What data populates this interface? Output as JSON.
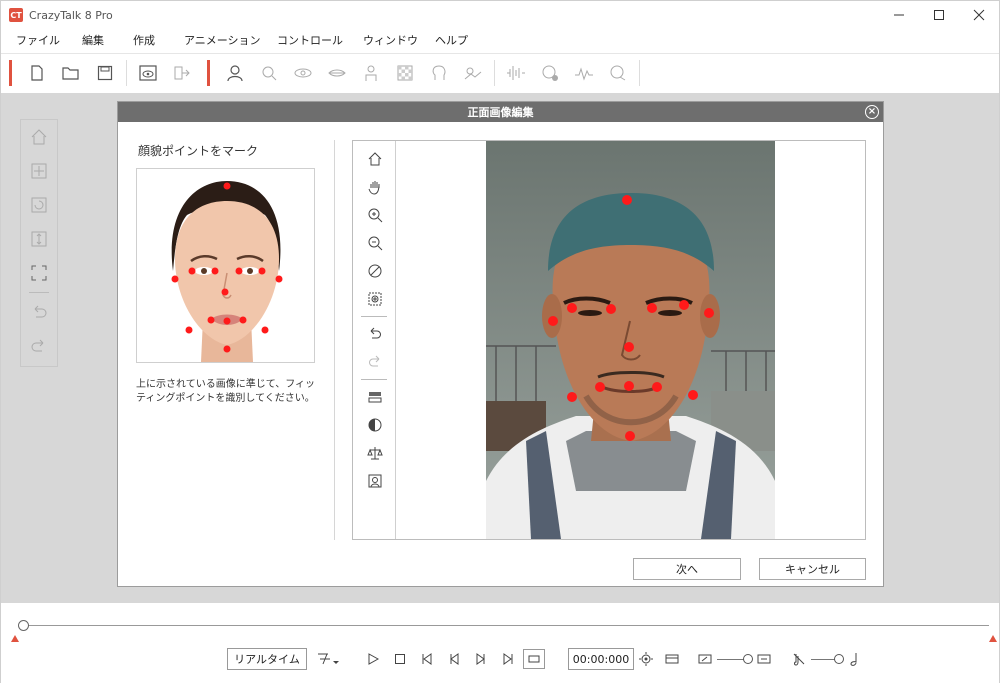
{
  "app": {
    "title": "CrazyTalk 8 Pro"
  },
  "window_controls": {
    "minimize": "—",
    "maximize": "☐",
    "close": "✕"
  },
  "menu": [
    "ファイル",
    "編集",
    "作成",
    "アニメーション",
    "コントロール",
    "ウィンドウ",
    "ヘルプ"
  ],
  "dialog": {
    "title": "正面画像編集",
    "instruction": "顔貌ポイントをマーク",
    "description": "上に示されている画像に準じて、フィッティングポイントを識別してください。",
    "next_button": "次へ",
    "cancel_button": "キャンセル"
  },
  "bottom_bar": {
    "realtime_button": "リアルタイム",
    "time": "00:00:000"
  },
  "colors": {
    "accent": "#e0523f",
    "marker": "#ff1a1a",
    "dialog_header": "#6e6e6e",
    "workspace": "#d7d7d7"
  }
}
